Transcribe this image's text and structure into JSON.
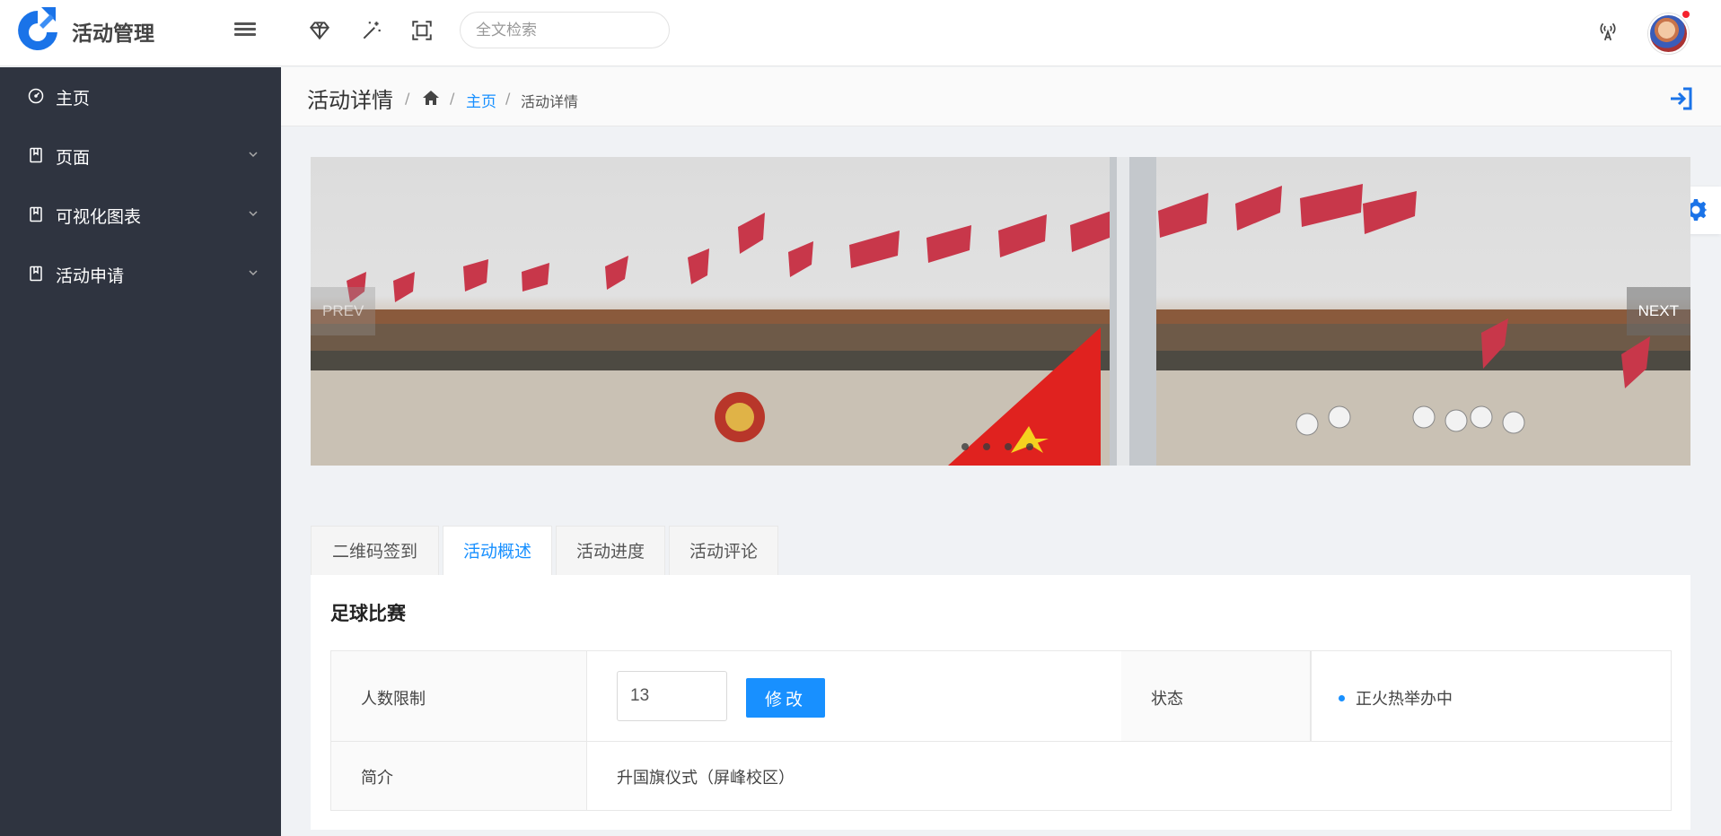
{
  "app": {
    "title": "活动管理"
  },
  "colors": {
    "accent": "#1890ff",
    "sidebar_bg": "#2f3440"
  },
  "header": {
    "search_placeholder": "全文检索",
    "icons": [
      "gem-icon",
      "magic-wand-icon",
      "fullscreen-icon",
      "broadcast-icon"
    ]
  },
  "sidebar": {
    "items": [
      {
        "label": "主页",
        "icon": "dashboard-icon",
        "expandable": false
      },
      {
        "label": "页面",
        "icon": "book-icon",
        "expandable": true
      },
      {
        "label": "可视化图表",
        "icon": "book-icon",
        "expandable": true
      },
      {
        "label": "活动申请",
        "icon": "book-icon",
        "expandable": true
      }
    ]
  },
  "breadcrumb": {
    "title": "活动详情",
    "home_link": "主页",
    "current": "活动详情",
    "separator": "/"
  },
  "carousel": {
    "prev_label": "PREV",
    "next_label": "NEXT",
    "slide_count": 4
  },
  "tabs": [
    {
      "label": "二维码签到",
      "active": false
    },
    {
      "label": "活动概述",
      "active": true
    },
    {
      "label": "活动进度",
      "active": false
    },
    {
      "label": "活动评论",
      "active": false
    }
  ],
  "activity": {
    "name": "足球比赛",
    "limit_label": "人数限制",
    "limit_value": "13",
    "modify_button": "修改",
    "status_label": "状态",
    "status_value": "正火热举办中",
    "intro_label": "简介",
    "intro_value": "升国旗仪式（屏峰校区）"
  }
}
